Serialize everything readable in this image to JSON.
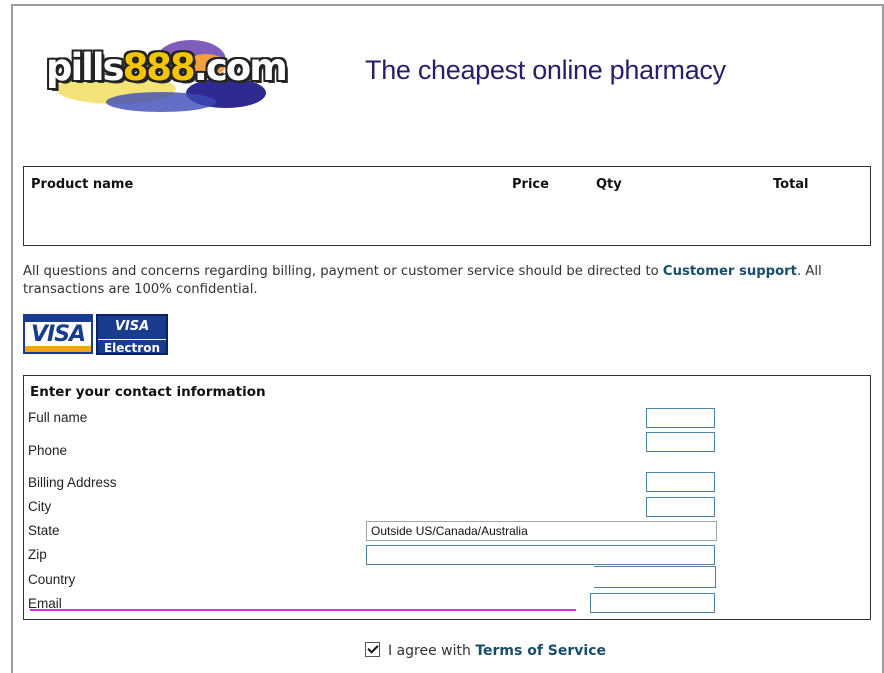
{
  "header": {
    "logo_text_part1": "pills",
    "logo_text_part2": "888",
    "logo_text_part3": ".com",
    "tagline": "The cheapest online pharmacy"
  },
  "cart": {
    "columns": [
      "Product name",
      "Price",
      "Qty",
      "Total"
    ]
  },
  "info": {
    "text_before": "All questions and concerns regarding billing, payment or customer service should be directed to ",
    "support_link": "Customer support",
    "text_after": ". All transactions are 100% confidential."
  },
  "cards": {
    "visa": "VISA",
    "electron_top": "VISA",
    "electron_bottom": "Electron"
  },
  "contact": {
    "title": "Enter your contact information",
    "labels": {
      "full_name": "Full name",
      "phone": "Phone",
      "billing_address": "Billing Address",
      "city": "City",
      "state": "State",
      "zip": "Zip",
      "country": "Country",
      "email": "Email"
    },
    "state_value": "Outside US/Canada/Australia"
  },
  "agree": {
    "text": "I agree with ",
    "link": "Terms of Service",
    "checked": true
  },
  "colors": {
    "tagline": "#2a1e6b",
    "link": "#184e6b",
    "field_border": "#4e83a6",
    "email_underline": "#e52be0"
  }
}
